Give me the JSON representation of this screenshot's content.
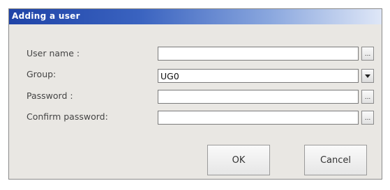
{
  "window": {
    "title": "Adding a user"
  },
  "form": {
    "username_label": "User name :",
    "username_value": "",
    "username_browse": "...",
    "group_label": "Group:",
    "group_value": "UG0",
    "password_label": "Password :",
    "password_value": "",
    "password_browse": "...",
    "confirm_label": "Confirm password:",
    "confirm_value": "",
    "confirm_browse": "..."
  },
  "buttons": {
    "ok": "OK",
    "cancel": "Cancel"
  },
  "icons": {
    "group_dropdown": "chevron-down-icon"
  }
}
